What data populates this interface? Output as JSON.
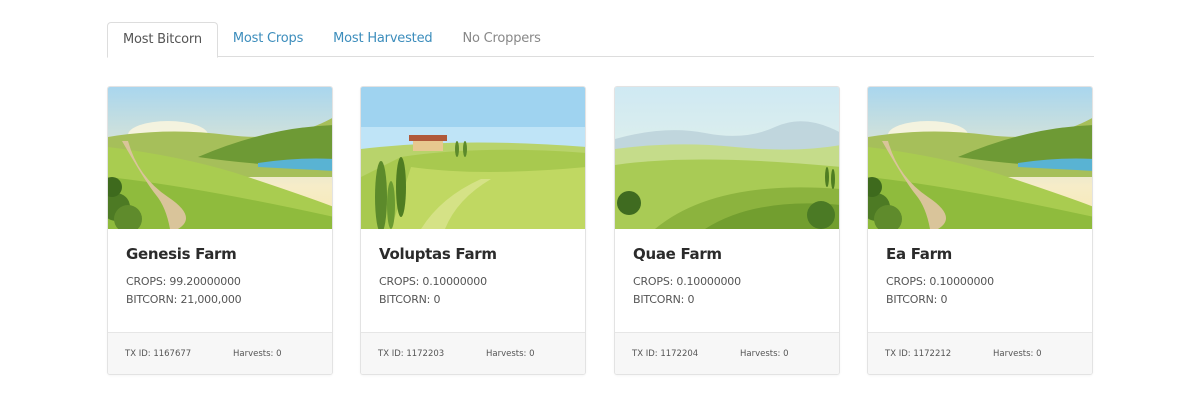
{
  "tabs": [
    {
      "label": "Most Bitcorn",
      "active": true
    },
    {
      "label": "Most Crops",
      "active": false
    },
    {
      "label": "Most Harvested",
      "active": false
    },
    {
      "label": "No Croppers",
      "active": false
    }
  ],
  "farms": [
    {
      "name": "Genesis Farm",
      "crops": "CROPS: 99.20000000",
      "bitcorn": "BITCORN: 21,000,000",
      "tx": "TX ID: 1167677",
      "harvests": "Harvests: 0",
      "image": "farm-landscape-river"
    },
    {
      "name": "Voluptas Farm",
      "crops": "CROPS: 0.10000000",
      "bitcorn": "BITCORN: 0",
      "tx": "TX ID: 1172203",
      "harvests": "Harvests: 0",
      "image": "farm-landscape-villa"
    },
    {
      "name": "Quae Farm",
      "crops": "CROPS: 0.10000000",
      "bitcorn": "BITCORN: 0",
      "tx": "TX ID: 1172204",
      "harvests": "Harvests: 0",
      "image": "farm-landscape-hills"
    },
    {
      "name": "Ea Farm",
      "crops": "CROPS: 0.10000000",
      "bitcorn": "BITCORN: 0",
      "tx": "TX ID: 1172212",
      "harvests": "Harvests: 0",
      "image": "farm-landscape-river"
    }
  ],
  "colors": {
    "tab_link": "#3c8dbc",
    "tab_muted": "#888888",
    "sky": "#bfe4f7",
    "grass_light": "#b9d46a",
    "grass_dark": "#7da93a"
  }
}
